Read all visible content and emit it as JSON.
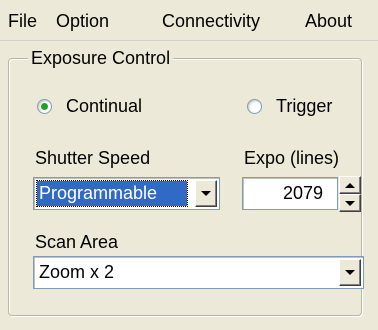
{
  "menu": {
    "file": "File",
    "option": "Option",
    "connectivity": "Connectivity",
    "about": "About"
  },
  "exposure_control": {
    "title": "Exposure Control",
    "mode_options": [
      {
        "label": "Continual",
        "checked": true
      },
      {
        "label": "Trigger",
        "checked": false
      }
    ],
    "shutter_speed_label": "Shutter Speed",
    "shutter_speed_value": "Programmable",
    "expo_label": "Expo (lines)",
    "expo_value": "2079",
    "scan_area_label": "Scan Area",
    "scan_area_value": "Zoom x 2"
  },
  "icons": {
    "dropdown": "chevron-down-icon",
    "spin_up": "arrow-up-icon",
    "spin_down": "arrow-down-icon"
  },
  "colors": {
    "window_bg": "#ece9d8",
    "selection": "#316ac5",
    "radio_dot": "#21a121",
    "field_border": "#7f9db9"
  }
}
